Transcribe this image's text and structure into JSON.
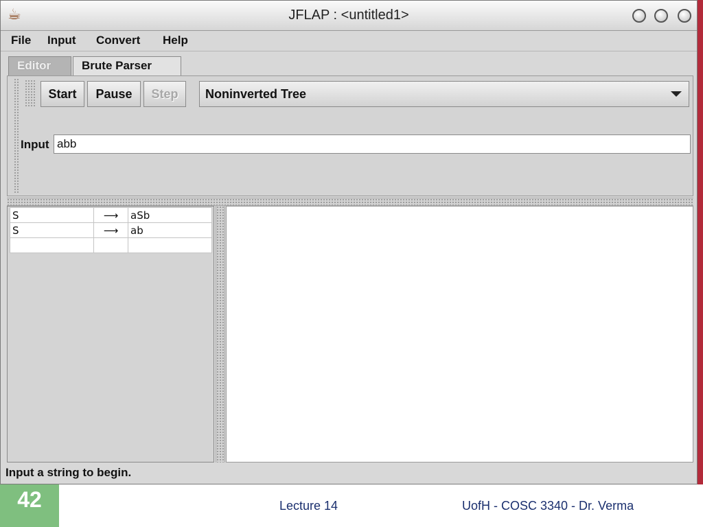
{
  "window": {
    "title": "JFLAP : <untitled1>",
    "icon": "java-cup-icon"
  },
  "menu": {
    "items": [
      "File",
      "Input",
      "Convert",
      "Help"
    ]
  },
  "tabs": [
    {
      "label": "Editor",
      "state": "disabled"
    },
    {
      "label": "Brute Parser",
      "state": "selected"
    }
  ],
  "toolbar": {
    "start_label": "Start",
    "pause_label": "Pause",
    "step_label": "Step",
    "view_select_value": "Noninverted Tree"
  },
  "input": {
    "label": "Input",
    "value": "abb"
  },
  "grammar": {
    "rows": [
      {
        "lhs": "S",
        "arrow": "⟶",
        "rhs": "aSb"
      },
      {
        "lhs": "S",
        "arrow": "⟶",
        "rhs": "ab"
      },
      {
        "lhs": "",
        "arrow": "",
        "rhs": ""
      }
    ]
  },
  "status": {
    "text": "Input a string to begin."
  },
  "slide": {
    "page_number": "42",
    "lecture": "Lecture 14",
    "course": "UofH - COSC 3340 - Dr. Verma"
  },
  "colors": {
    "page_box": "#7fbf7f",
    "footer_text": "#1a2f6e",
    "window_bg": "#d8d8d8"
  }
}
